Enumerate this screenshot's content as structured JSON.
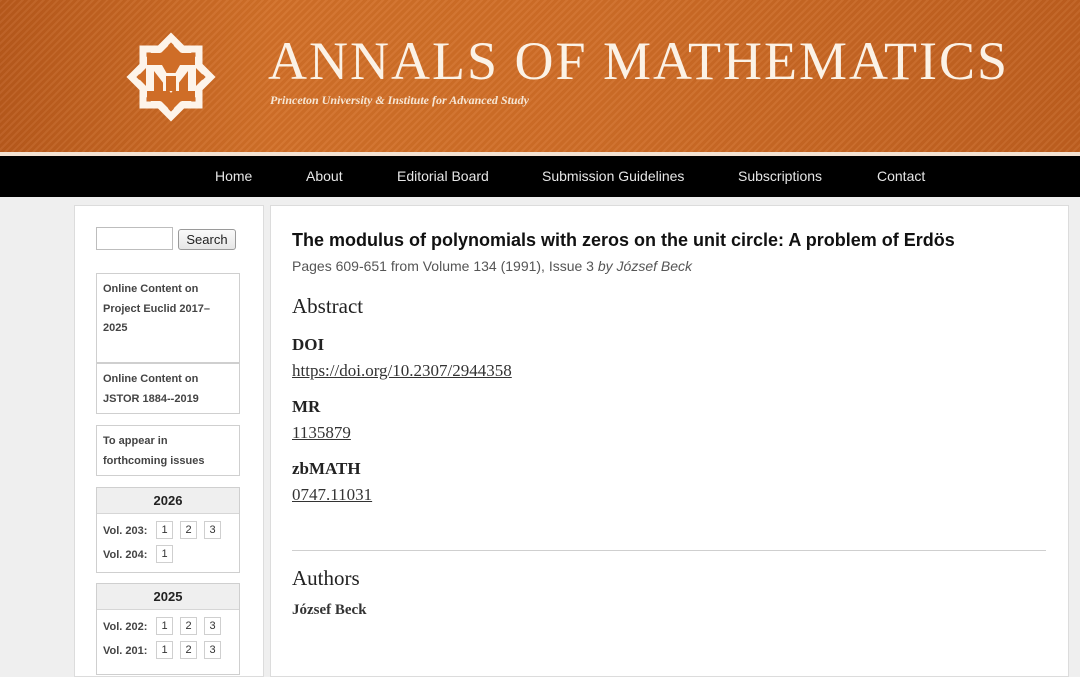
{
  "header": {
    "title": "ANNALS OF MATHEMATICS",
    "subtitle": "Princeton University & Institute for Advanced Study",
    "logo_icon": "am-monogram-icon",
    "colors": {
      "banner": "#cf6d27",
      "nav": "#000000"
    }
  },
  "nav": {
    "items": [
      {
        "label": "Home"
      },
      {
        "label": "About"
      },
      {
        "label": "Editorial Board"
      },
      {
        "label": "Submission Guidelines"
      },
      {
        "label": "Subscriptions"
      },
      {
        "label": "Contact"
      }
    ]
  },
  "sidebar": {
    "search": {
      "button_label": "Search",
      "value": ""
    },
    "links": [
      {
        "label": "Online Content on Project Euclid 2017–2025"
      },
      {
        "label": "Online Content on JSTOR 1884--2019"
      },
      {
        "label": "To appear in forthcoming issues"
      }
    ],
    "years": [
      {
        "year": "2026",
        "volumes": [
          {
            "label": "Vol. 203:",
            "issues": [
              "1",
              "2",
              "3"
            ]
          },
          {
            "label": "Vol. 204:",
            "issues": [
              "1"
            ]
          }
        ]
      },
      {
        "year": "2025",
        "volumes": [
          {
            "label": "Vol. 202:",
            "issues": [
              "1",
              "2",
              "3"
            ]
          },
          {
            "label": "Vol. 201:",
            "issues": [
              "1",
              "2",
              "3"
            ]
          }
        ]
      }
    ]
  },
  "article": {
    "title": "The modulus of polynomials with zeros on the unit circle: A problem of Erdös",
    "pages_text": "Pages 609-651 from Volume 134 (1991), Issue 3",
    "by_text": "by József Beck",
    "abstract_heading": "Abstract",
    "doi_label": "DOI",
    "doi_value": "https://doi.org/10.2307/2944358",
    "mr_label": "MR",
    "mr_value": "1135879",
    "zbmath_label": "zbMATH",
    "zbmath_value": "0747.11031",
    "authors_heading": "Authors",
    "authors": [
      "József Beck"
    ]
  }
}
